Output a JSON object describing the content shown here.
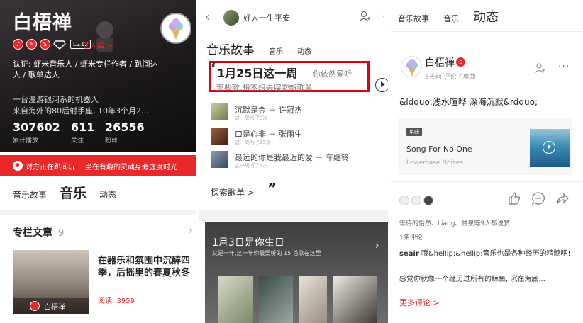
{
  "profile": {
    "name": "白梧禅",
    "level": "Lv.12",
    "tag": "艺人店 >",
    "cert": "认证: 虾米音乐人 / 虾米专栏作者 / 趴间达人 / 歌单达人",
    "bio_line1": "一台漫游银河系的机器人",
    "bio_line2": "来自海外的80后射手座, 10年3个月2...",
    "stats": [
      {
        "value": "307602",
        "label": "累计播放"
      },
      {
        "value": "611",
        "label": "关注"
      },
      {
        "value": "26556",
        "label": "粉丝"
      }
    ],
    "live_bar": {
      "left": "对方正在趴间玩",
      "right": "坐在有趣的灵魂身旁虚度时光"
    },
    "tabs": [
      "音乐故事",
      "音乐",
      "动态"
    ],
    "section_title": "专栏文章",
    "section_count": "9",
    "article": {
      "title": "在器乐和氛围中沉醉四季，后摇里的春夏秋冬",
      "author": "白梧禅",
      "reads": "阅读: 3959"
    },
    "accent": "#e8282b"
  },
  "story": {
    "username": "好人一生平安",
    "tabs": [
      "音乐故事",
      "音乐",
      "动态"
    ],
    "quote": {
      "date": "1月25日这一周",
      "text_right": "你依然爱听",
      "text_line2": "那些歌,想不想去探索新歌单"
    },
    "songs": [
      {
        "title": "沉默是金 － 许冠杰",
        "meta": "这一周听了3次"
      },
      {
        "title": "口是心非 － 张雨生",
        "meta": "这一周听了15次"
      },
      {
        "title": "最远的你是我最近的爱 － 车继铃",
        "meta": "这一周听了4次"
      }
    ],
    "explore": "探索歌单 >",
    "explore_mark": "”",
    "birthday": {
      "title": "1月3日是你生日",
      "sub": "又是一年,这一年你最爱听的 15 首歌在这里"
    }
  },
  "feed": {
    "tabs": [
      "音乐故事",
      "音乐",
      "动态"
    ],
    "user": "白梧禅",
    "meta": "3天前 评论了单曲",
    "text": "&ldquo;浅水喧哗 深海沉默&rdquo;",
    "card": {
      "tag": "单曲",
      "song": "Song For No One",
      "artist": "Lowercase Noises"
    },
    "likes": "等待的怡然、Liang、甘泉等9人都说赞",
    "comment_count": "1条评论",
    "comment": {
      "author": "seair",
      "text": "哦&hellip;&hellip;音乐也是各种经历的精髓吧!",
      "line2": "感觉你就像一个经历过所有的鲸鱼, 沉在海底..."
    },
    "more": "更多评论 >"
  }
}
